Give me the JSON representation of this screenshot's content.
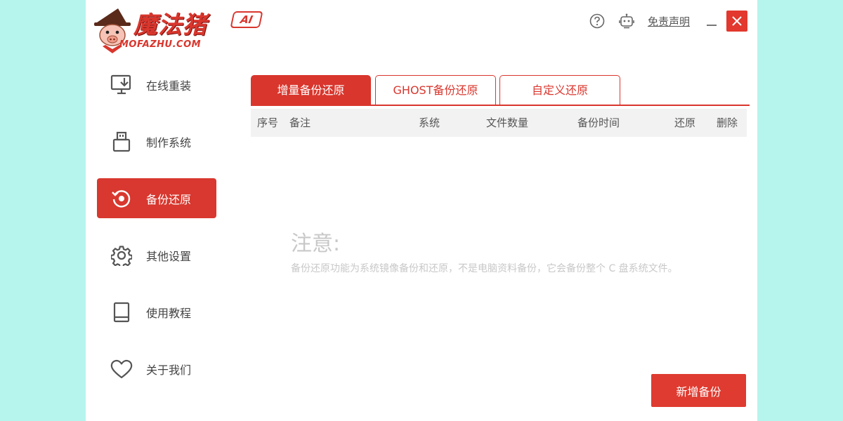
{
  "app": {
    "logo_title": "魔法猪",
    "logo_sub": "MOFAZHU.COM",
    "logo_badge": "AI"
  },
  "topbar": {
    "disclaimer": "免责声明"
  },
  "sidebar": {
    "items": [
      {
        "label": "在线重装"
      },
      {
        "label": "制作系统"
      },
      {
        "label": "备份还原"
      },
      {
        "label": "其他设置"
      },
      {
        "label": "使用教程"
      },
      {
        "label": "关于我们"
      }
    ]
  },
  "tabs": [
    {
      "label": "增量备份还原"
    },
    {
      "label": "GHOST备份还原"
    },
    {
      "label": "自定义还原"
    }
  ],
  "table": {
    "columns": [
      "序号",
      "备注",
      "系统",
      "文件数量",
      "备份时间",
      "还原",
      "删除"
    ]
  },
  "notice": {
    "title": "注意:",
    "body": "备份还原功能为系统镜像备份和还原，不是电脑资料备份，它会备份整个 C 盘系统文件。"
  },
  "actions": {
    "add_backup": "新增备份"
  },
  "colors": {
    "accent": "#d9362d",
    "background": "#b6f5ee"
  }
}
